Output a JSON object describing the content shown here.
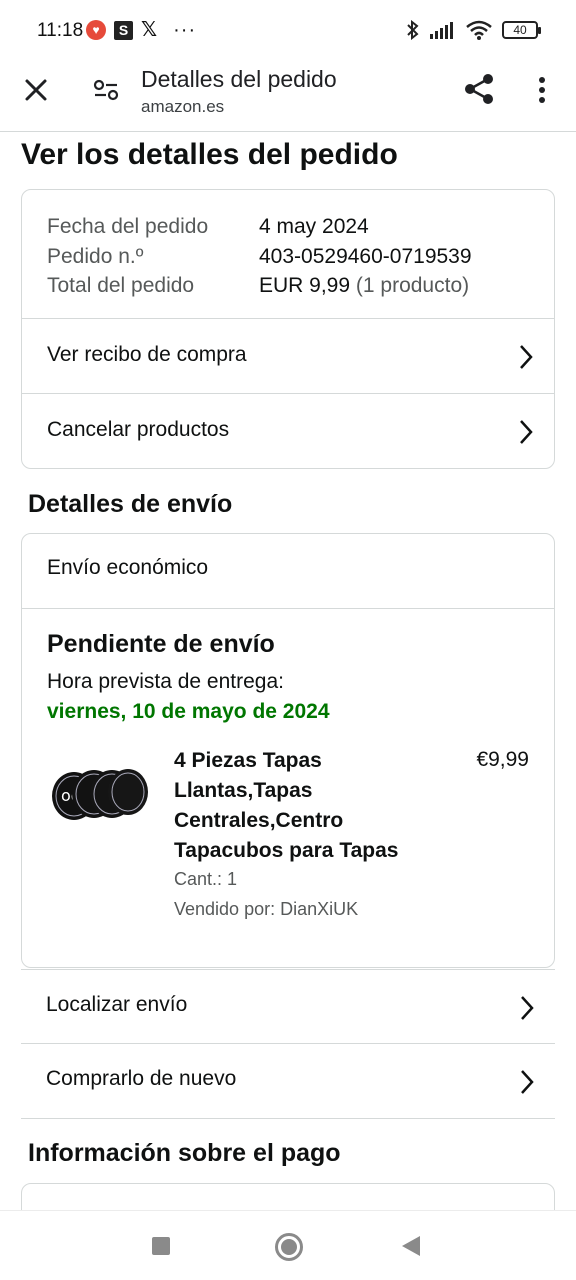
{
  "status_bar": {
    "time": "11:18",
    "battery": "40",
    "icons": [
      "heart-app-icon",
      "s-app-icon",
      "x-app-icon",
      "more-notifications-icon",
      "bluetooth-icon",
      "signal-icon",
      "wifi-icon",
      "battery-icon"
    ],
    "s_glyph": "S",
    "x_glyph": "𝕏",
    "dots": "···"
  },
  "app_bar": {
    "title": "Detalles del pedido",
    "url": "amazon.es"
  },
  "page": {
    "title": "Ver los detalles del pedido"
  },
  "order_summary": {
    "rows": [
      {
        "label": "Fecha del pedido",
        "value": "4 may 2024"
      },
      {
        "label": "Pedido n.º",
        "value": "403-0529460-0719539"
      },
      {
        "label": "Total del pedido",
        "value": "EUR 9,99",
        "extra": "(1 producto)"
      }
    ],
    "links": [
      {
        "label": "Ver recibo de compra"
      },
      {
        "label": "Cancelar productos"
      }
    ]
  },
  "shipping": {
    "heading": "Detalles de envío",
    "type": "Envío económico",
    "status": "Pendiente de envío",
    "eta_label": "Hora prevista de entrega:",
    "eta_date": "viernes, 10 de mayo de 2024",
    "product": {
      "title": "4 Piezas Tapas Llantas,Tapas Centrales,Centro Tapacubos para Tapas",
      "price": "€9,99",
      "quantity": "Cant.: 1",
      "seller": "Vendido por: DianXiUK"
    },
    "links": [
      {
        "label": "Localizar envío"
      },
      {
        "label": "Comprarlo de nuevo"
      }
    ]
  },
  "payment": {
    "heading": "Información sobre el pago"
  },
  "colors": {
    "eta_green": "#007600",
    "border": "#d5d9d9",
    "muted": "#565959"
  }
}
